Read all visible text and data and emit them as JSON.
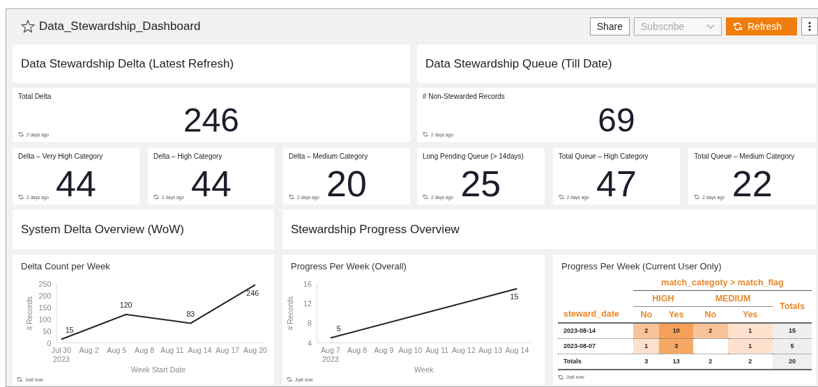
{
  "dashboard": {
    "title": "Data_Stewardship_Dashboard",
    "actions": [
      {
        "kind": "share",
        "label": "Share"
      },
      {
        "kind": "subscribe",
        "label": "Subscribe",
        "disabled": true
      },
      {
        "kind": "refresh",
        "label": "Refresh"
      },
      {
        "kind": "more"
      }
    ]
  },
  "panels": [
    {
      "title": "Data Stewardship Delta (Latest Refresh)",
      "total": {
        "label": "Total Delta",
        "value": "246",
        "updated": "2 days ago"
      },
      "tiles": [
        {
          "label": "Delta – Very High Category",
          "value": "44",
          "updated": "2 days ago"
        },
        {
          "label": "Delta – High Category",
          "value": "44",
          "updated": "2 days ago"
        },
        {
          "label": "Delta – Medium Category",
          "value": "20",
          "updated": "2 days ago"
        }
      ]
    },
    {
      "title": "Data Stewardship Queue (Till Date)",
      "total": {
        "label": "# Non-Stewarded Records",
        "value": "69",
        "updated": "2 days ago"
      },
      "tiles": [
        {
          "label": "Long Pending Queue (> 14days)",
          "value": "25",
          "updated": "2 days ago"
        },
        {
          "label": "Total Queue – High Category",
          "value": "47",
          "updated": "2 days ago"
        },
        {
          "label": "Total Queue – Medium Category",
          "value": "22",
          "updated": "2 days ago"
        }
      ]
    }
  ],
  "overview_titles": [
    "System Delta Overview (WoW)",
    "Stewardship Progress Overview"
  ],
  "charts": [
    {
      "title": "Delta Count per Week",
      "updated": "Just now",
      "chart_data": {
        "type": "line",
        "xlabel": "Week Start Date",
        "ylabel": "# Records",
        "x": [
          "2023-07-30",
          "2023-08-06",
          "2023-08-13",
          "2023-08-20"
        ],
        "series": [
          {
            "color": "#222222",
            "values": [
              15,
              120,
              83,
              246
            ]
          }
        ],
        "xlim": [
          "2023-07-29T12:00:00Z",
          "2023-08-21T00:00:00Z"
        ],
        "ylim": [
          0,
          250
        ],
        "yticks": [
          0,
          50,
          100,
          150,
          200,
          250
        ],
        "xticks": [
          {
            "value": "2023-07-30",
            "label": "Jul 30\n2023"
          },
          {
            "value": "2023-08-02",
            "label": "Aug 2"
          },
          {
            "value": "2023-08-05",
            "label": "Aug 5"
          },
          {
            "value": "2023-08-08",
            "label": "Aug 8"
          },
          {
            "value": "2023-08-11",
            "label": "Aug 11"
          },
          {
            "value": "2023-08-14",
            "label": "Aug 14"
          },
          {
            "value": "2023-08-17",
            "label": "Aug 17"
          },
          {
            "value": "2023-08-20",
            "label": "Aug 20"
          }
        ],
        "data_labels": true
      }
    },
    {
      "title": "Progress Per Week (Overall)",
      "updated": "Just now",
      "chart_data": {
        "type": "line",
        "xlabel": "Week",
        "ylabel": "# Records",
        "x": [
          "2023-08-07",
          "2023-08-14"
        ],
        "series": [
          {
            "color": "#222222",
            "values": [
              5,
              15
            ]
          }
        ],
        "xlim": [
          "2023-08-06T12:00:00Z",
          "2023-08-14T12:00:00Z"
        ],
        "ylim": [
          4,
          16
        ],
        "yticks": [
          4,
          8,
          12,
          16
        ],
        "xticks": [
          {
            "value": "2023-08-07",
            "label": "Aug 7\n2023"
          },
          {
            "value": "2023-08-08",
            "label": "Aug 8"
          },
          {
            "value": "2023-08-09",
            "label": "Aug 9"
          },
          {
            "value": "2023-08-10",
            "label": "Aug 10"
          },
          {
            "value": "2023-08-11",
            "label": "Aug 11"
          },
          {
            "value": "2023-08-12",
            "label": "Aug 12"
          },
          {
            "value": "2023-08-13",
            "label": "Aug 13"
          },
          {
            "value": "2023-08-14",
            "label": "Aug 14"
          }
        ],
        "data_labels": true
      }
    }
  ],
  "user_progress": {
    "title": "Progress Per Week (Current User Only)",
    "updated": "Just now",
    "pivot": {
      "column_group_title": "match_categoty > match_flag",
      "row_header": "steward_date",
      "totals_header": "Totals",
      "groups": [
        {
          "label": "HIGH",
          "columns": [
            "No",
            "Yes"
          ]
        },
        {
          "label": "MEDIUM",
          "columns": [
            "No",
            "Yes"
          ]
        }
      ],
      "rows": [
        {
          "label": "2023-08-14",
          "cells": [
            {
              "value": "2",
              "color": "#f9c39a"
            },
            {
              "value": "10",
              "color": "#f5a05a"
            },
            {
              "value": "2",
              "color": "#f9c39a"
            },
            {
              "value": "1",
              "color": "#fde1cd"
            }
          ],
          "total": "15"
        },
        {
          "label": "2023-08-07",
          "cells": [
            {
              "value": "1",
              "color": "#fde1cd"
            },
            {
              "value": "3",
              "color": "#f6a866"
            },
            {
              "color": "#ffffff"
            },
            {
              "value": "1",
              "color": "#fde1cd"
            }
          ],
          "total": "5"
        }
      ],
      "totals_row": {
        "label": "Totals",
        "values": [
          "3",
          "13",
          "2",
          "2"
        ],
        "total": "20"
      }
    }
  }
}
